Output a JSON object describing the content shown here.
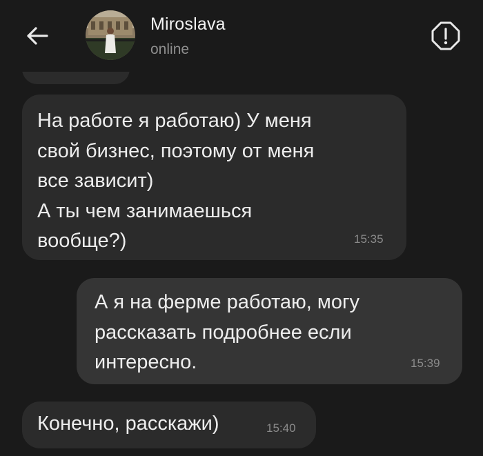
{
  "header": {
    "contact_name": "Miroslava",
    "status": "online",
    "back_icon": "arrow-left-icon",
    "report_icon": "alert-circle-icon"
  },
  "messages": [
    {
      "direction": "incoming",
      "text": "На работе я работаю) У меня\nсвой бизнес, поэтому от меня\nвсе зависит)\nА ты чем занимаешься\nвообще?)",
      "time": "15:35"
    },
    {
      "direction": "outgoing",
      "text": "А я на ферме работаю, могу\nрассказать подробнее если\nинтересно.",
      "time": "15:39"
    },
    {
      "direction": "incoming",
      "text": "Конечно, расскажи)",
      "time": "15:40"
    }
  ],
  "colors": {
    "background": "#1a1a1a",
    "incoming_bubble": "#2b2b2b",
    "outgoing_bubble": "#353535",
    "text": "#ededed",
    "muted": "#8e8e8e"
  }
}
